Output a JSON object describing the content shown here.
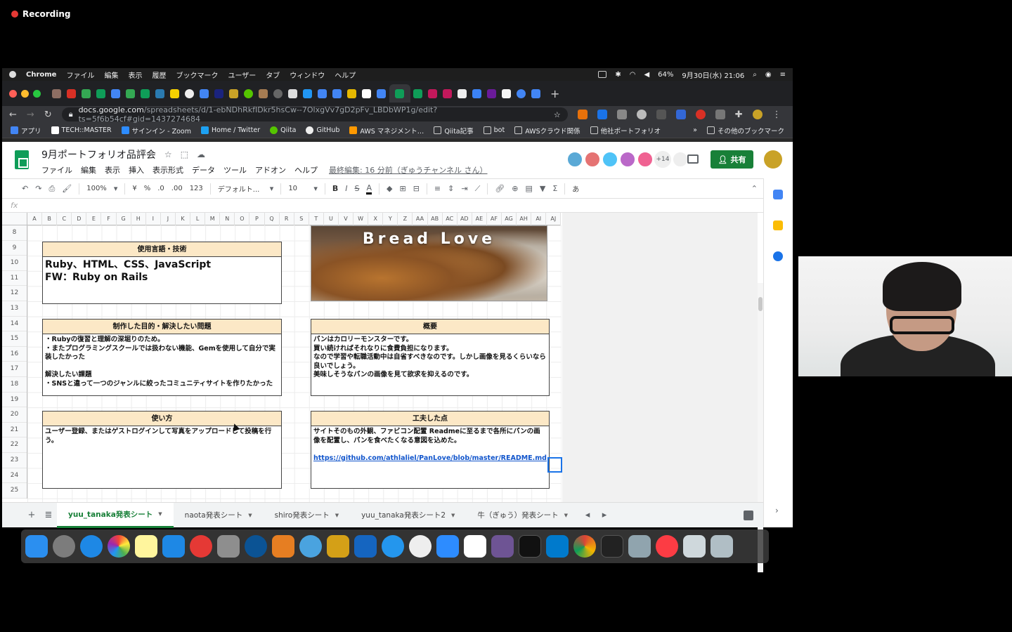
{
  "recording": {
    "label": "Recording"
  },
  "menubar": {
    "app": "Chrome",
    "items": [
      "ファイル",
      "編集",
      "表示",
      "履歴",
      "ブックマーク",
      "ユーザー",
      "タブ",
      "ウィンドウ",
      "ヘルプ"
    ],
    "battery": "64%",
    "clock": "9月30日(水) 21:06"
  },
  "browser": {
    "url_host": "docs.google.com",
    "url_path": "/spreadsheets/d/1-ebNDhRkfIDkr5hsCw--7OlxgVv7gD2pFv_LBDbWP1g/edit?ts=5f6b54cf#gid=1437274684",
    "bookmarks": [
      "アプリ",
      "TECH::MASTER",
      "サインイン - Zoom",
      "Home / Twitter",
      "Qiita",
      "GitHub",
      "AWS マネジメント…",
      "Qiita記事",
      "bot",
      "AWSクラウド関係",
      "他社ポートフォリオ"
    ],
    "bookmarks_more": "»",
    "other_bookmarks": "その他のブックマーク"
  },
  "doc": {
    "title": "9月ポートフォリオ品評会",
    "menu": [
      "ファイル",
      "編集",
      "表示",
      "挿入",
      "表示形式",
      "データ",
      "ツール",
      "アドオン",
      "ヘルプ"
    ],
    "last_edit": "最終編集: 16 分前（ぎゅうチャンネル さん）",
    "collab_more": "+14",
    "share_label": "共有"
  },
  "format_bar": {
    "zoom": "100%",
    "currency": "¥",
    "percent": "%",
    "dec_less": ".0",
    "dec_more": ".00",
    "number_format": "123",
    "font": "デフォルト...",
    "font_size": "10",
    "input_mode": "あ"
  },
  "formula": {
    "fx": "fx"
  },
  "columns": [
    "A",
    "B",
    "C",
    "D",
    "E",
    "F",
    "G",
    "H",
    "I",
    "J",
    "K",
    "L",
    "M",
    "N",
    "O",
    "P",
    "Q",
    "R",
    "S",
    "T",
    "U",
    "V",
    "W",
    "X",
    "Y",
    "Z",
    "AA",
    "AB",
    "AC",
    "AD",
    "AE",
    "AF",
    "AG",
    "AH",
    "AI",
    "AJ"
  ],
  "rows": [
    "8",
    "9",
    "10",
    "11",
    "12",
    "13",
    "14",
    "15",
    "16",
    "17",
    "18",
    "19",
    "20",
    "21",
    "22",
    "23",
    "24",
    "25"
  ],
  "cards": {
    "tech": {
      "header": "使用言語・技術",
      "body": "Ruby、HTML、CSS、JavaScript\nFW：Ruby on Rails"
    },
    "purpose": {
      "header": "制作した目的・解決したい問題",
      "body": "・Rubyの復習と理解の深堀りのため。\n・またプログラミングスクールでは扱わない機能、Gemを使用して自分で実装したかった\n\n解決したい課題\n・SNSと違って一つのジャンルに絞ったコミュニティサイトを作りたかった"
    },
    "overview": {
      "header": "概要",
      "body": "パンはカロリーモンスターです。\n買い続ければそれなりに食費負担になります。\nなので学習や転職活動中は自省すべきなのです。しかし画像を見るくらいなら良いでしょう。\n美味しそうなパンの画像を見て欲求を抑えるのです。"
    },
    "usage": {
      "header": "使い方",
      "body": "ユーザー登録、またはゲストログインして写真をアップロードして投稿を行う。"
    },
    "ideas": {
      "header": "工夫した点",
      "body": "サイトそのもの外観、ファビコン配置 Readmeに至るまで各所にパンの画像を配置し、パンを食べたくなる意図を込めた。",
      "link": "https://github.com/athlaliel/PanLove/blob/master/README.md"
    }
  },
  "banner": {
    "title": "Bread Love"
  },
  "sheet_tabs": [
    "yuu_tanaka発表シート",
    "naota発表シート",
    "shiro発表シート",
    "yuu_tanaka発表シート2",
    "牛（ぎゅう）発表シート"
  ],
  "colors": {
    "accent": "#188038",
    "header_fill": "#fce8c6",
    "link": "#1155cc"
  }
}
